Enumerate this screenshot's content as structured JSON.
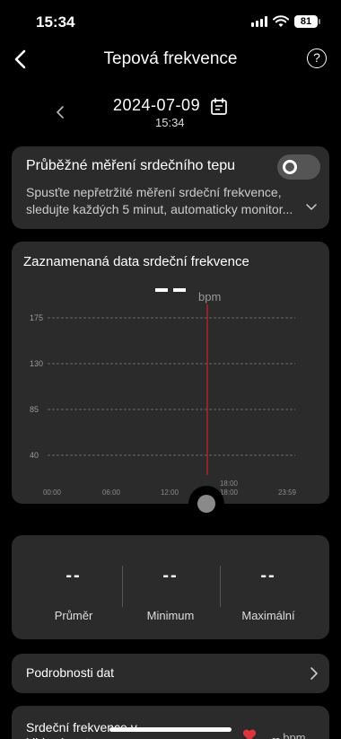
{
  "status_bar": {
    "time": "15:34",
    "battery": "81"
  },
  "nav": {
    "title": "Tepová frekvence",
    "help_icon": "?"
  },
  "date_selector": {
    "date": "2024-07-09",
    "time": "15:34"
  },
  "continuous_measure": {
    "title": "Průběžné měření srdečního tepu",
    "description": "Spusťte nepřetržité měření srdeční frekvence, sledujte každých 5 minut, automaticky monitor...",
    "enabled": false
  },
  "recorded_chart": {
    "title": "Zaznamenaná data srdeční frekvence",
    "unit": "bpm"
  },
  "chart_data": {
    "type": "line",
    "title": "Zaznamenaná data srdeční frekvence",
    "ylabel": "bpm",
    "y_ticks": [
      "175",
      "130",
      "85",
      "40"
    ],
    "x_ticks": [
      "00:00",
      "06:00",
      "12:00",
      "18:00",
      "23:59"
    ],
    "ylim": [
      40,
      175
    ],
    "grid": true,
    "series": [],
    "cursor_time": "15:34",
    "selected_value_label": "18:00",
    "colors": {
      "cursor": "#c8242c",
      "grid": "#6a6a6a"
    }
  },
  "stats": [
    {
      "value": "--",
      "label": "Průměr"
    },
    {
      "value": "--",
      "label": "Minimum"
    },
    {
      "value": "--",
      "label": "Maximální"
    }
  ],
  "details_row": {
    "label": "Podrobnosti dat"
  },
  "resting_row": {
    "label": "Srdeční frekvence v klidovém stavu",
    "trailing": "-- bpm"
  }
}
